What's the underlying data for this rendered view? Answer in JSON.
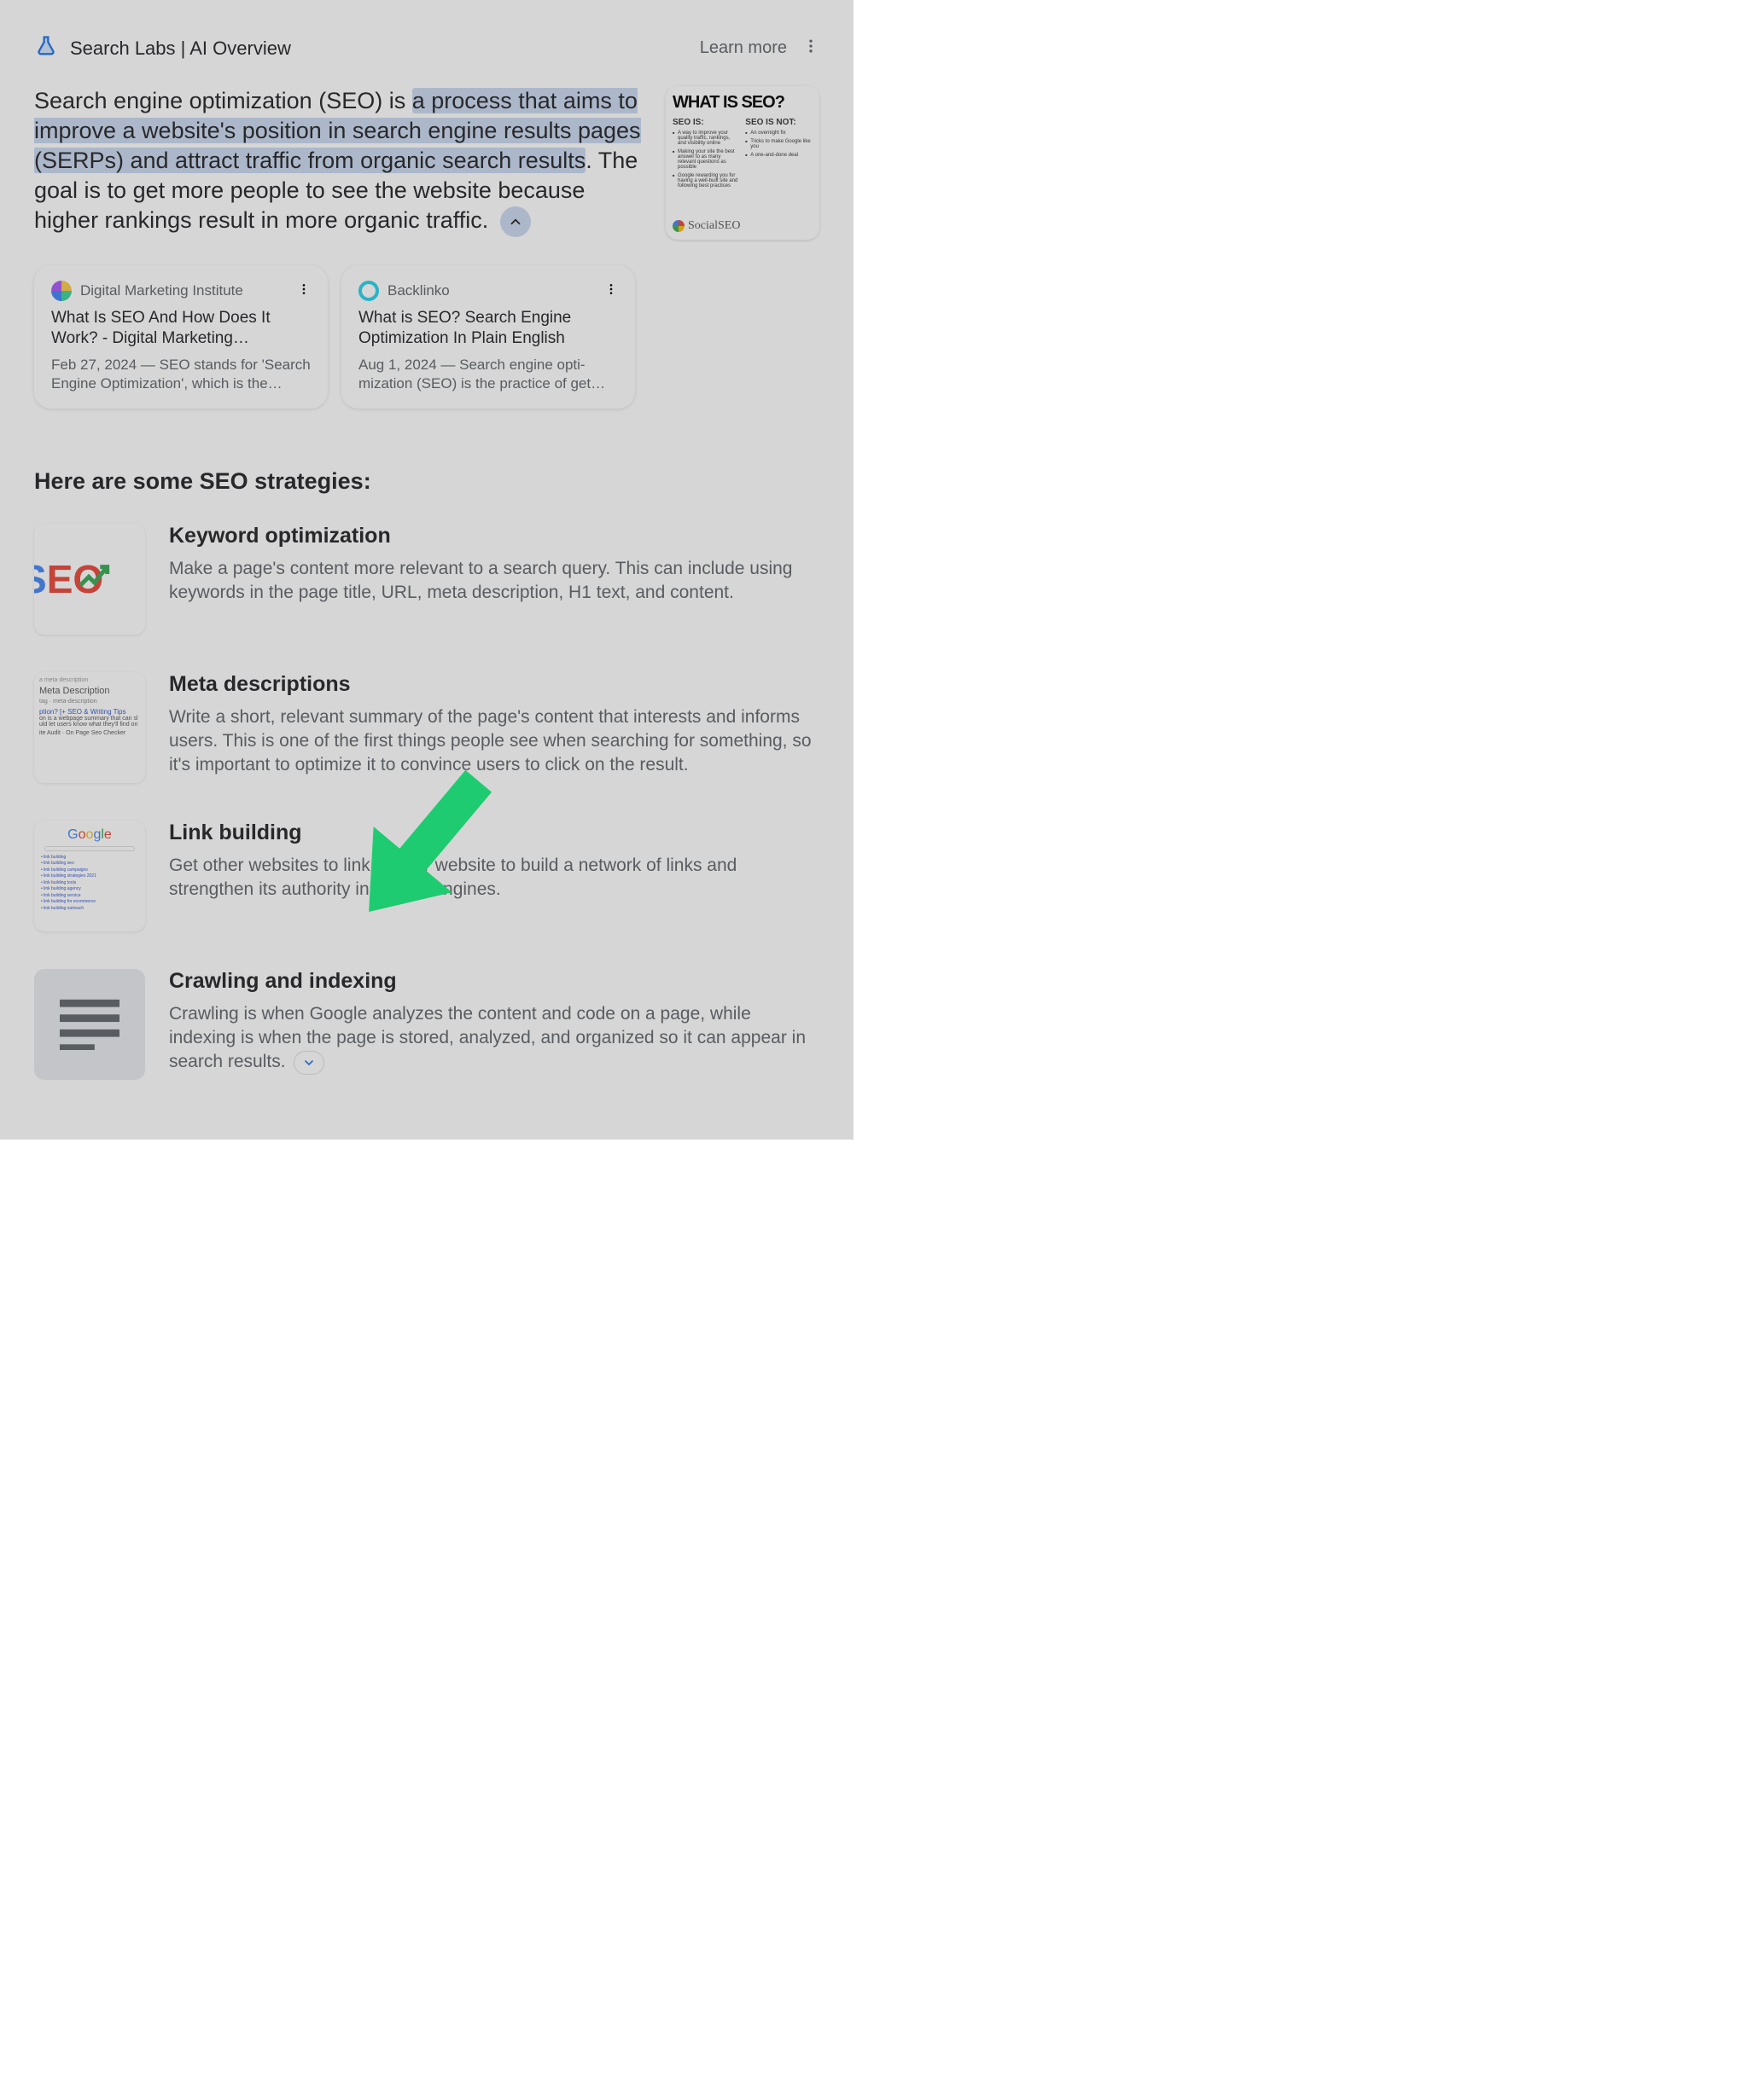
{
  "header": {
    "title": "Search Labs | AI Overview",
    "learn_more": "Learn more"
  },
  "summary": {
    "prefix": "Search engine optimization (SEO) is ",
    "highlight": "a process that aims to improve a website's position in search engine results pages (SERPs) and attract traffic from organic search results",
    "suffix": ". The goal is to get more people to see the website because higher rankings result in more organic traffic. "
  },
  "side_card": {
    "title": "WHAT IS SEO?",
    "col_is": "SEO IS:",
    "col_isnot": "SEO IS NOT:",
    "is_items": [
      "A way to improve your quality traffic, rankings, and visibility online",
      "Making your site the best answer to as many relevant questions as possible",
      "Google rewarding you for having a well-built site and following best practices"
    ],
    "isnot_items": [
      "An overnight fix",
      "Tricks to make Google like you",
      "A one-and-done deal"
    ],
    "brand": "SocialSEO"
  },
  "cards": [
    {
      "source": "Digital Marketing Institute",
      "title": "What Is SEO And How Does It Work? - Digital Marketing…",
      "snippet": "Feb 27, 2024 — SEO stands for 'Search Engine Optimization', which is the…",
      "icon_gradient": "conic-gradient(#f9c846 0 25%, #36d399 25% 50%, #3b82f6 50% 75%, #a855f7 75% 100%)"
    },
    {
      "source": "Backlinko",
      "title": "What is SEO? Search Engine Optimization In Plain English",
      "snippet": "Aug 1, 2024 — Search engine opti­mization (SEO) is the practice of get­…",
      "icon_color": "#22d3ee"
    }
  ],
  "strategies_heading": "Here are some SEO strategies:",
  "strategies": [
    {
      "title": "Keyword optimization",
      "desc": "Make a page's content more relevant to a search query. This can include using keywords in the page title, URL, meta description, H1 text, and content."
    },
    {
      "title": "Meta descriptions",
      "desc": "Write a short, relevant summary of the page's content that interests and informs users. This is one of the first things people see when searching for something, so it's important to optimize it to convince users to click on the result."
    },
    {
      "title": "Link building",
      "desc": "Get other websites to link to your website to build a network of links and strengthen its authority in search engines."
    },
    {
      "title": "Crawling and indexing",
      "desc": "Crawling is when Google analyzes the content and code on a page, while indexing is when the page is stored, analyzed, and organized so it can appear in search results. "
    }
  ],
  "meta_thumb": {
    "line1": "a meta description",
    "line2": "Meta Description",
    "line3": "tag · meta-description",
    "line4": "ption? [+ SEO & Writing Tips",
    "line5": "on is a webpage summary that can sl",
    "line6": "uld let users know what they'll find on",
    "line7": "ite Audit · On Page Seo Checker"
  },
  "link_thumb": {
    "google": "Google"
  }
}
